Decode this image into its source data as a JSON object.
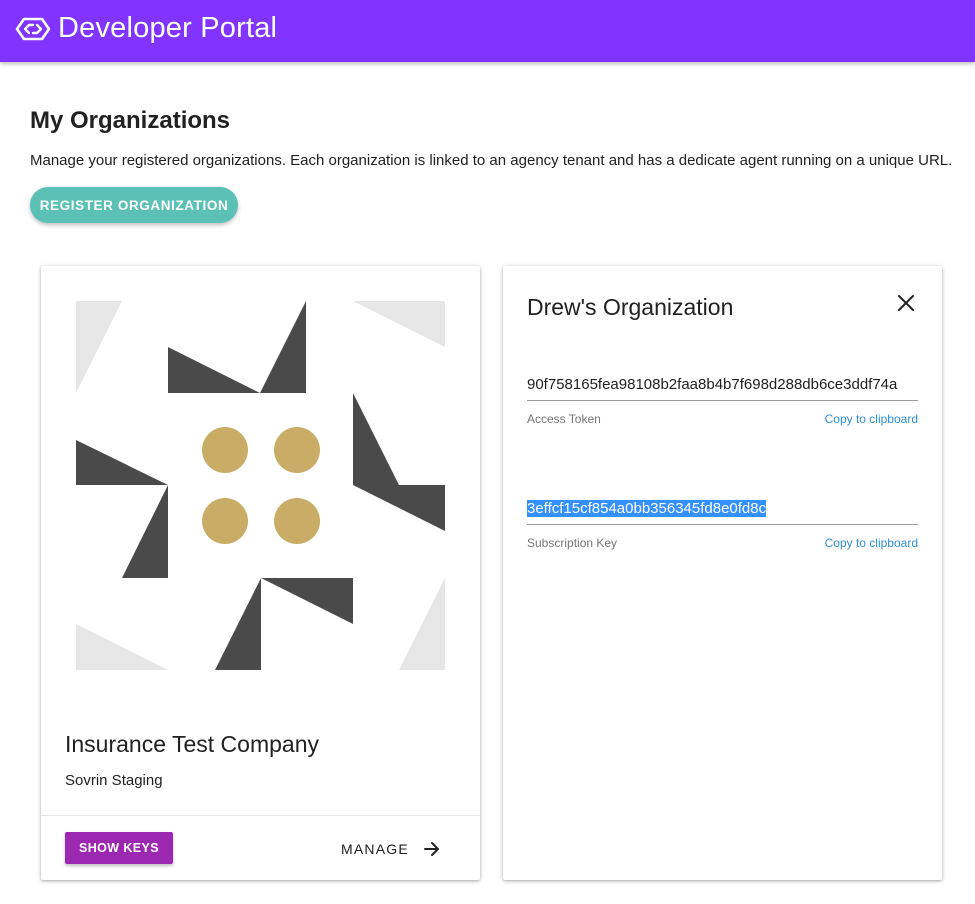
{
  "appbar": {
    "title": "Developer Portal",
    "logo_icon": "link-logo-icon",
    "color": "#8133ff"
  },
  "page": {
    "title": "My Organizations",
    "description": "Manage your registered organizations. Each organization is linked to an agency tenant and has a dedicate agent running on a unique URL.",
    "register_button": "REGISTER ORGANIZATION"
  },
  "org_card": {
    "name": "Insurance Test Company",
    "network": "Sovrin Staging",
    "show_keys_button": "SHOW KEYS",
    "manage_link": "MANAGE",
    "manage_icon": "arrow-right-icon",
    "avatar_colors": {
      "dark": "#4a4a4a",
      "light": "#e6e6e6",
      "gold": "#c9ac66"
    }
  },
  "keys_card": {
    "title": "Drew's Organization",
    "close_icon": "close-icon",
    "access_token": {
      "value": "90f758165fea98108b2faa8b4b7f698d288db6ce3ddf74a",
      "label": "Access Token",
      "copy": "Copy to clipboard"
    },
    "subscription_key": {
      "value": "3effcf15cf854a0bb356345fd8e0fd8c",
      "label": "Subscription Key",
      "copy": "Copy to clipboard"
    }
  },
  "colors": {
    "register_button": "#5bc0b5",
    "show_keys_button": "#9c27b0",
    "copy_link": "#2f8fd6",
    "selection": "#3390ff"
  }
}
